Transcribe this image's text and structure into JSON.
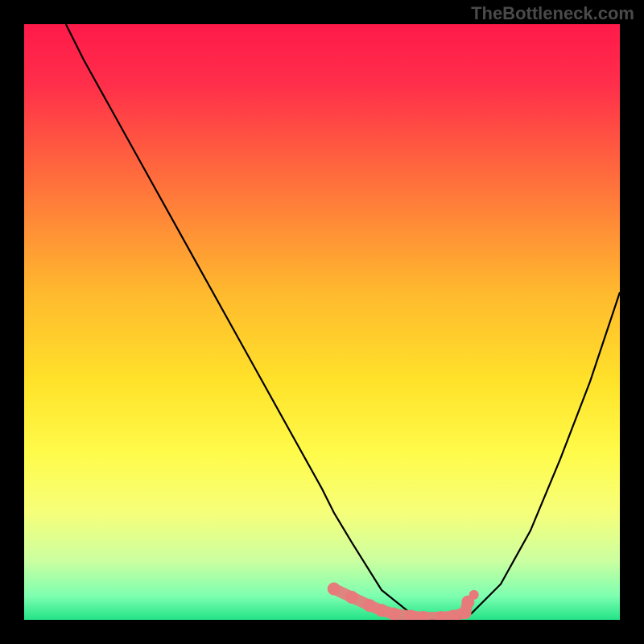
{
  "watermark": "TheBottleneck.com",
  "chart_data": {
    "type": "line",
    "title": "",
    "xlabel": "",
    "ylabel": "",
    "xlim": [
      0,
      100
    ],
    "ylim": [
      0,
      100
    ],
    "background_gradient": {
      "stops": [
        {
          "offset": 0.0,
          "color": "#ff1a4a"
        },
        {
          "offset": 0.1,
          "color": "#ff2e4a"
        },
        {
          "offset": 0.25,
          "color": "#ff6a3d"
        },
        {
          "offset": 0.45,
          "color": "#ffb92e"
        },
        {
          "offset": 0.6,
          "color": "#ffe22a"
        },
        {
          "offset": 0.72,
          "color": "#fffb4a"
        },
        {
          "offset": 0.82,
          "color": "#f6ff7a"
        },
        {
          "offset": 0.9,
          "color": "#ccffa0"
        },
        {
          "offset": 0.96,
          "color": "#7dffb0"
        },
        {
          "offset": 1.0,
          "color": "#23e387"
        }
      ]
    },
    "series": [
      {
        "name": "bottleneck-curve",
        "color": "#000000",
        "x": [
          7,
          10,
          15,
          20,
          25,
          30,
          35,
          40,
          45,
          50,
          52,
          55,
          60,
          65,
          67,
          70,
          72,
          75,
          80,
          85,
          90,
          95,
          100
        ],
        "y": [
          100,
          94,
          85,
          76,
          67,
          58,
          49,
          40,
          31,
          22,
          18,
          13,
          5,
          1,
          0,
          0,
          0,
          1,
          6,
          15,
          27,
          40,
          55
        ]
      }
    ],
    "highlight_marker": {
      "name": "optimal-range-marker",
      "color": "#e77b7b",
      "x": [
        52,
        55,
        58,
        60,
        62,
        65,
        67,
        70,
        72,
        74,
        74.5
      ],
      "y": [
        5.2,
        3.8,
        2.4,
        1.6,
        1.0,
        0.6,
        0.4,
        0.4,
        0.6,
        1.2,
        3.0
      ]
    }
  }
}
